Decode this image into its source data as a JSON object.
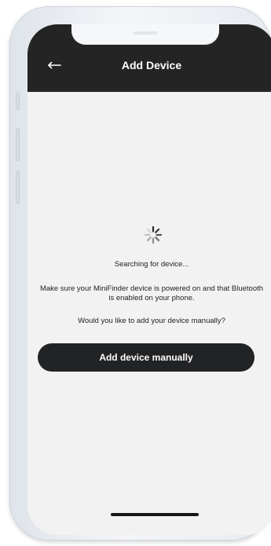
{
  "header": {
    "title": "Add Device",
    "back_icon": "arrow-left-icon"
  },
  "main": {
    "spinner_icon": "loading-spinner-icon",
    "status_text": "Searching for device...",
    "info_text": "Make sure your MiniFinder device is powered on and that Bluetooth is enabled on your phone.",
    "question_text": "Would you like to add your device manually?",
    "add_manually_label": "Add device manually"
  },
  "colors": {
    "header_background": "#242424",
    "screen_background": "#f2f2f2",
    "primary_button": "#222325",
    "text": "#222222"
  }
}
